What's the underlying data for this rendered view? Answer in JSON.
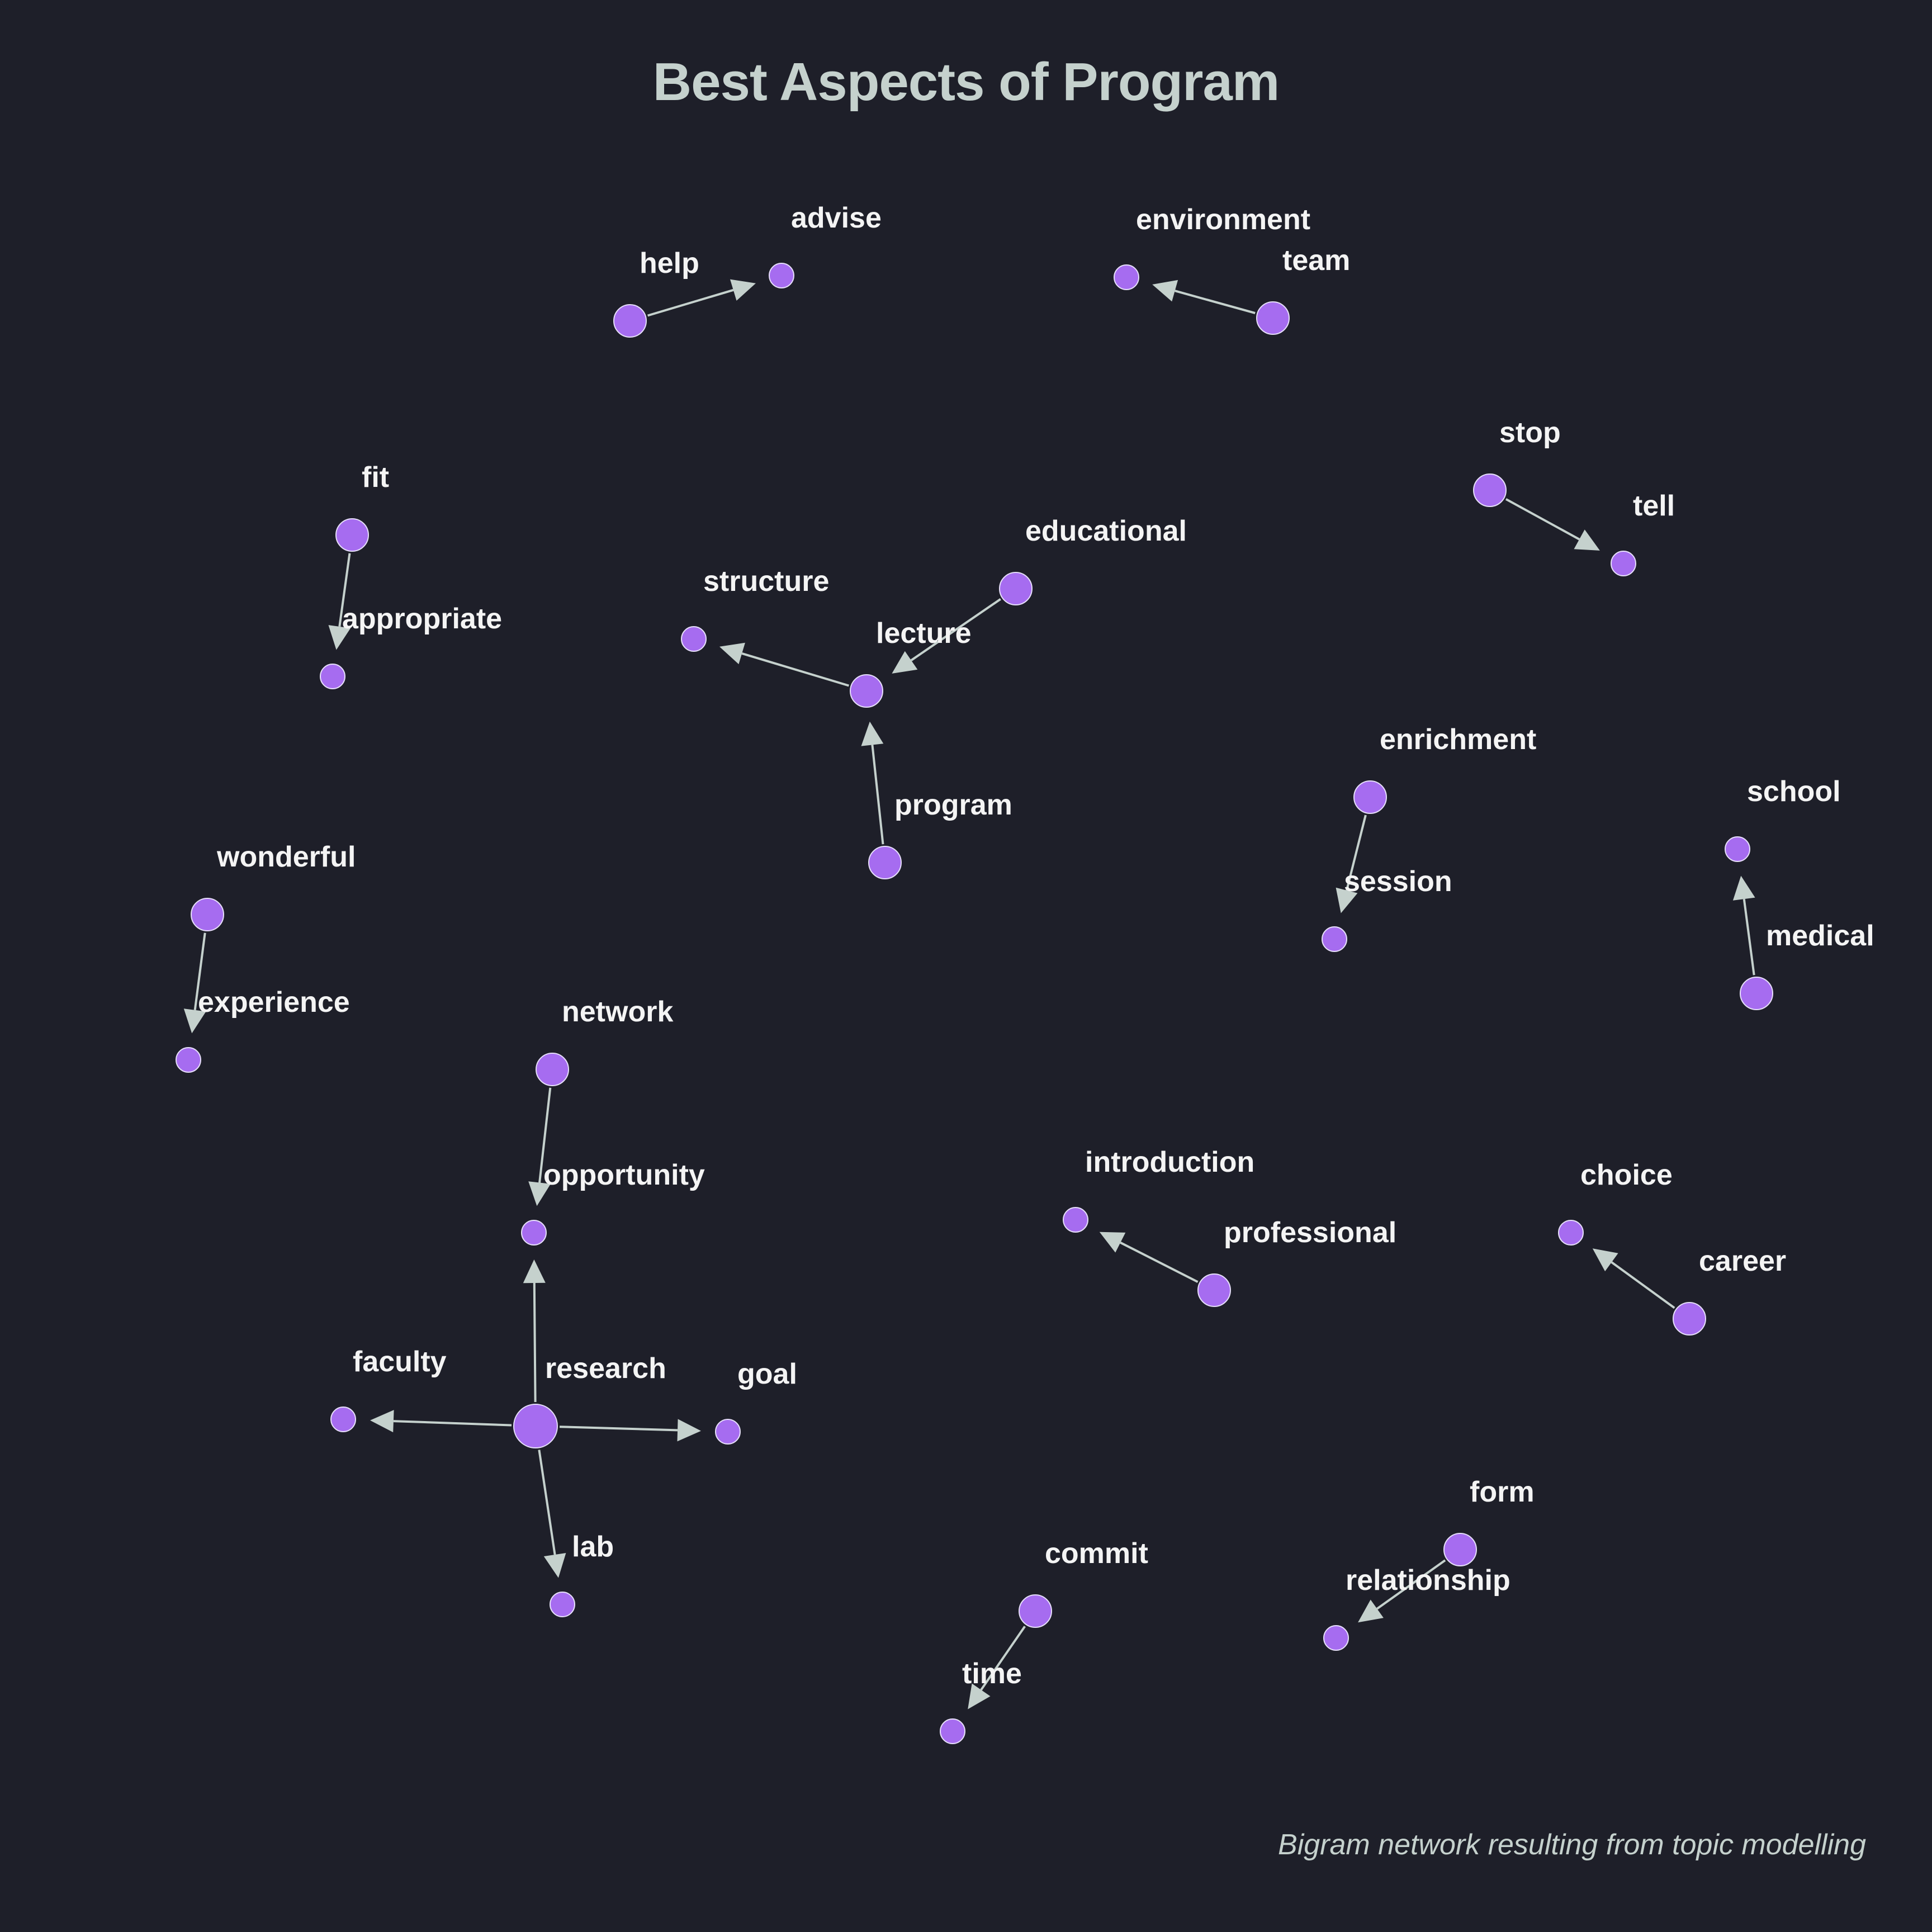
{
  "title": "Best Aspects of Program",
  "caption": "Bigram network resulting from topic modelling",
  "colors": {
    "background": "#1e1f29",
    "node": "#a66cf0",
    "edge": "#c5d1cd",
    "label": "#f4f4f4"
  },
  "nodes": [
    {
      "id": "help",
      "label": "help",
      "size": "medium"
    },
    {
      "id": "advise",
      "label": "advise",
      "size": "small"
    },
    {
      "id": "environment",
      "label": "environment",
      "size": "small"
    },
    {
      "id": "team",
      "label": "team",
      "size": "medium"
    },
    {
      "id": "stop",
      "label": "stop",
      "size": "medium"
    },
    {
      "id": "tell",
      "label": "tell",
      "size": "small"
    },
    {
      "id": "fit",
      "label": "fit",
      "size": "medium"
    },
    {
      "id": "appropriate",
      "label": "appropriate",
      "size": "small"
    },
    {
      "id": "educational",
      "label": "educational",
      "size": "medium"
    },
    {
      "id": "structure",
      "label": "structure",
      "size": "small"
    },
    {
      "id": "lecture",
      "label": "lecture",
      "size": "medium"
    },
    {
      "id": "program",
      "label": "program",
      "size": "medium"
    },
    {
      "id": "enrichment",
      "label": "enrichment",
      "size": "medium"
    },
    {
      "id": "session",
      "label": "session",
      "size": "small"
    },
    {
      "id": "school",
      "label": "school",
      "size": "small"
    },
    {
      "id": "medical",
      "label": "medical",
      "size": "medium"
    },
    {
      "id": "wonderful",
      "label": "wonderful",
      "size": "medium"
    },
    {
      "id": "experience",
      "label": "experience",
      "size": "small"
    },
    {
      "id": "network",
      "label": "network",
      "size": "medium"
    },
    {
      "id": "opportunity",
      "label": "opportunity",
      "size": "small"
    },
    {
      "id": "introduction",
      "label": "introduction",
      "size": "small"
    },
    {
      "id": "professional",
      "label": "professional",
      "size": "medium"
    },
    {
      "id": "choice",
      "label": "choice",
      "size": "small"
    },
    {
      "id": "career",
      "label": "career",
      "size": "medium"
    },
    {
      "id": "faculty",
      "label": "faculty",
      "size": "small"
    },
    {
      "id": "research",
      "label": "research",
      "size": "large"
    },
    {
      "id": "goal",
      "label": "goal",
      "size": "small"
    },
    {
      "id": "lab",
      "label": "lab",
      "size": "small"
    },
    {
      "id": "form",
      "label": "form",
      "size": "medium"
    },
    {
      "id": "relationship",
      "label": "relationship",
      "size": "small"
    },
    {
      "id": "commit",
      "label": "commit",
      "size": "medium"
    },
    {
      "id": "time",
      "label": "time",
      "size": "small"
    }
  ],
  "edges": [
    {
      "from": "help",
      "to": "advise"
    },
    {
      "from": "team",
      "to": "environment"
    },
    {
      "from": "stop",
      "to": "tell"
    },
    {
      "from": "fit",
      "to": "appropriate"
    },
    {
      "from": "educational",
      "to": "lecture"
    },
    {
      "from": "lecture",
      "to": "structure"
    },
    {
      "from": "program",
      "to": "lecture"
    },
    {
      "from": "enrichment",
      "to": "session"
    },
    {
      "from": "medical",
      "to": "school"
    },
    {
      "from": "wonderful",
      "to": "experience"
    },
    {
      "from": "network",
      "to": "opportunity"
    },
    {
      "from": "professional",
      "to": "introduction"
    },
    {
      "from": "career",
      "to": "choice"
    },
    {
      "from": "research",
      "to": "opportunity"
    },
    {
      "from": "research",
      "to": "faculty"
    },
    {
      "from": "research",
      "to": "goal"
    },
    {
      "from": "research",
      "to": "lab"
    },
    {
      "from": "form",
      "to": "relationship"
    },
    {
      "from": "commit",
      "to": "time"
    }
  ]
}
